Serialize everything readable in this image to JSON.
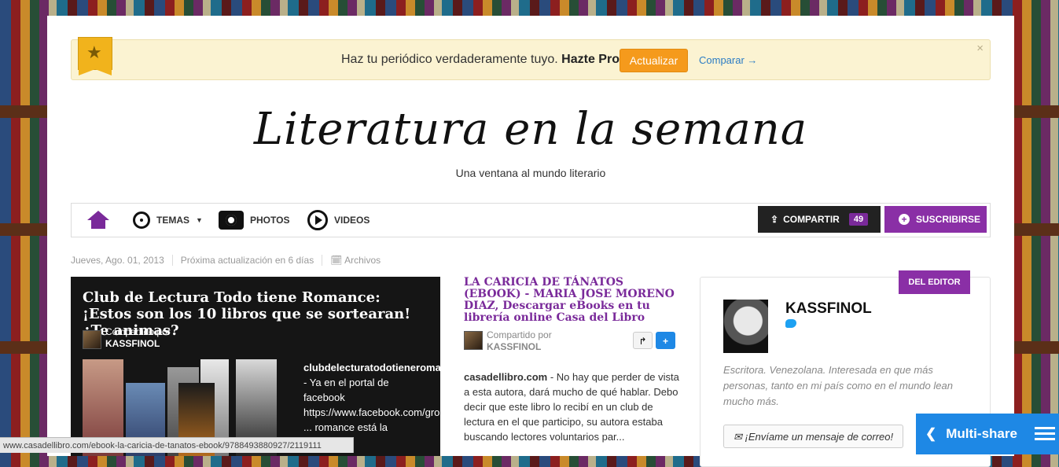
{
  "promo": {
    "text": "Haz tu periódico verdaderamente tuyo.",
    "bold": "Hazte Pro.",
    "button": "Actualizar",
    "compare": "Comparar →",
    "close": "×"
  },
  "header": {
    "title": "Literatura en la semana",
    "subtitle": "Una ventana al mundo literario"
  },
  "nav": {
    "temas": "TEMAS",
    "photos": "PHOTOS",
    "videos": "VIDEOS",
    "share_label": "COMPARTIR",
    "share_count": "49",
    "subscribe": "SUSCRIBIRSE"
  },
  "meta": {
    "date": "Jueves, Ago. 01, 2013",
    "next_update": "Próxima actualización en 6 días",
    "archives": "Archivos"
  },
  "feature": {
    "title": "Club de Lectura Todo tiene Romance: ¡Estos son los 10 libros que se sortearan! ¿Te animas?",
    "shared_label": "Compartido por",
    "shared_user": "KASSFINOL",
    "source": "clubdelecturatodotieneromance.blogspot.com",
    "excerpt": " - Ya en el portal de facebook https://www.facebook.com/groups/clubdelectu ... romance está la"
  },
  "middle": {
    "title": "LA CARICIA DE TÁNATOS (EBOOK) - MARIA JOSE MORENO DIAZ, Descargar eBooks en tu librería online Casa del Libro",
    "shared_label": "Compartido por",
    "shared_user": "KASSFINOL",
    "source": "casadellibro.com",
    "excerpt": " - No hay que perder de vista a esta autora, dará mucho de qué hablar. Debo decir que este libro lo recibí en un club de lectura en el que participo, su autora estaba buscando lectores voluntarios par..."
  },
  "editor": {
    "badge": "DEL EDITOR",
    "name": "KASSFINOL",
    "bio": "Escritora. Venezolana. Interesada en que más personas, tanto en mi país como en el mundo lean mucho más.",
    "mail": "¡Envíame un mensaje de correo!"
  },
  "status_url": "www.casadellibro.com/ebook-la-caricia-de-tanatos-ebook/9788493880927/2119111",
  "multishare": "Multi-share",
  "colors": {
    "accent": "#8a2fa6",
    "promo_button": "#f59a1c",
    "multishare": "#1e88e5"
  }
}
